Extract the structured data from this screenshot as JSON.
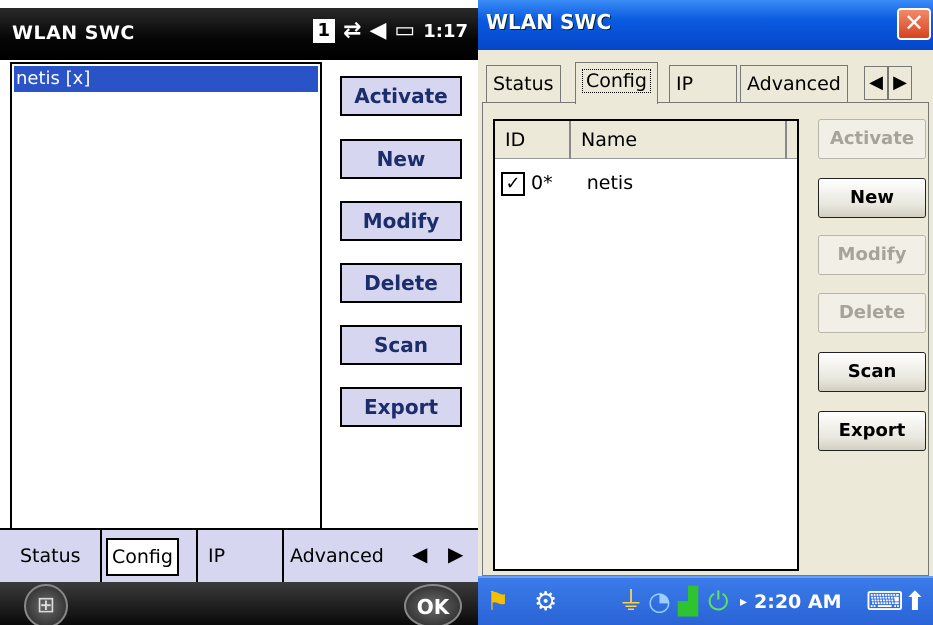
{
  "left": {
    "title": "WLAN SWC",
    "tray": {
      "indicator": "1",
      "time": "1:17",
      "data_icon": "sync-arrows-icon",
      "sound_icon": "speaker-icon",
      "battery_icon": "battery-icon"
    },
    "list": {
      "items": [
        "netis  [x]"
      ]
    },
    "buttons": {
      "activate": "Activate",
      "new": "New",
      "modify": "Modify",
      "delete": "Delete",
      "scan": "Scan",
      "export": "Export"
    },
    "tabs": {
      "status": "Status",
      "config": "Config",
      "ip": "IP",
      "advanced": "Advanced"
    },
    "softkeys": {
      "start_icon": "windows-start-icon",
      "ok": "OK"
    }
  },
  "right": {
    "title": "WLAN SWC",
    "close_icon": "close-icon",
    "tabs": {
      "status": "Status",
      "config": "Config",
      "ip": "IP",
      "advanced": "Advanced"
    },
    "table": {
      "columns": [
        "ID",
        "Name"
      ],
      "rows": [
        {
          "checked": true,
          "id": "0*",
          "name": "netis"
        }
      ]
    },
    "buttons": {
      "activate": "Activate",
      "new": "New",
      "modify": "Modify",
      "delete": "Delete",
      "scan": "Scan",
      "export": "Export"
    },
    "taskbar": {
      "time": "2:20 AM"
    },
    "colors": {
      "titlebar": "#0a5ae0",
      "taskbar": "#2a64d6",
      "left_title": "#000000",
      "left_selection": "#2b53c8",
      "left_button": "#d6d6f0"
    }
  }
}
